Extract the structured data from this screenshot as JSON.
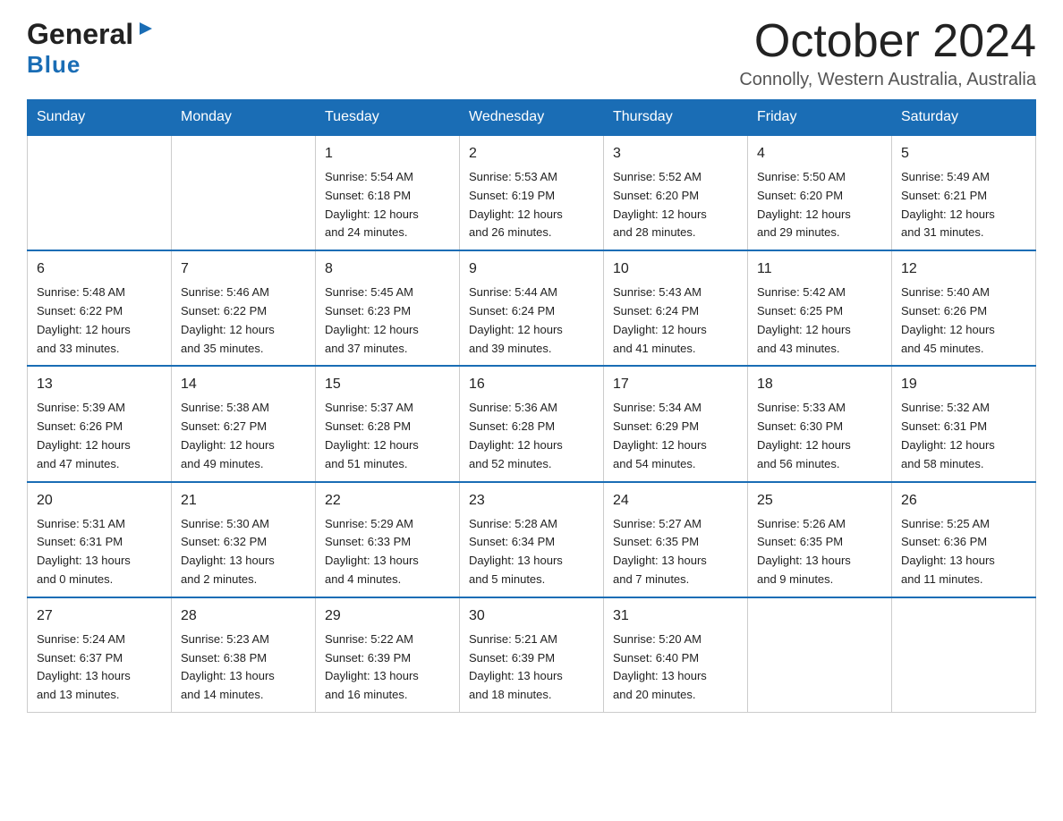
{
  "header": {
    "month_title": "October 2024",
    "location": "Connolly, Western Australia, Australia"
  },
  "logo": {
    "line1": "General",
    "line2": "Blue"
  },
  "days_of_week": [
    "Sunday",
    "Monday",
    "Tuesday",
    "Wednesday",
    "Thursday",
    "Friday",
    "Saturday"
  ],
  "weeks": [
    [
      {
        "day": "",
        "info": ""
      },
      {
        "day": "",
        "info": ""
      },
      {
        "day": "1",
        "info": "Sunrise: 5:54 AM\nSunset: 6:18 PM\nDaylight: 12 hours\nand 24 minutes."
      },
      {
        "day": "2",
        "info": "Sunrise: 5:53 AM\nSunset: 6:19 PM\nDaylight: 12 hours\nand 26 minutes."
      },
      {
        "day": "3",
        "info": "Sunrise: 5:52 AM\nSunset: 6:20 PM\nDaylight: 12 hours\nand 28 minutes."
      },
      {
        "day": "4",
        "info": "Sunrise: 5:50 AM\nSunset: 6:20 PM\nDaylight: 12 hours\nand 29 minutes."
      },
      {
        "day": "5",
        "info": "Sunrise: 5:49 AM\nSunset: 6:21 PM\nDaylight: 12 hours\nand 31 minutes."
      }
    ],
    [
      {
        "day": "6",
        "info": "Sunrise: 5:48 AM\nSunset: 6:22 PM\nDaylight: 12 hours\nand 33 minutes."
      },
      {
        "day": "7",
        "info": "Sunrise: 5:46 AM\nSunset: 6:22 PM\nDaylight: 12 hours\nand 35 minutes."
      },
      {
        "day": "8",
        "info": "Sunrise: 5:45 AM\nSunset: 6:23 PM\nDaylight: 12 hours\nand 37 minutes."
      },
      {
        "day": "9",
        "info": "Sunrise: 5:44 AM\nSunset: 6:24 PM\nDaylight: 12 hours\nand 39 minutes."
      },
      {
        "day": "10",
        "info": "Sunrise: 5:43 AM\nSunset: 6:24 PM\nDaylight: 12 hours\nand 41 minutes."
      },
      {
        "day": "11",
        "info": "Sunrise: 5:42 AM\nSunset: 6:25 PM\nDaylight: 12 hours\nand 43 minutes."
      },
      {
        "day": "12",
        "info": "Sunrise: 5:40 AM\nSunset: 6:26 PM\nDaylight: 12 hours\nand 45 minutes."
      }
    ],
    [
      {
        "day": "13",
        "info": "Sunrise: 5:39 AM\nSunset: 6:26 PM\nDaylight: 12 hours\nand 47 minutes."
      },
      {
        "day": "14",
        "info": "Sunrise: 5:38 AM\nSunset: 6:27 PM\nDaylight: 12 hours\nand 49 minutes."
      },
      {
        "day": "15",
        "info": "Sunrise: 5:37 AM\nSunset: 6:28 PM\nDaylight: 12 hours\nand 51 minutes."
      },
      {
        "day": "16",
        "info": "Sunrise: 5:36 AM\nSunset: 6:28 PM\nDaylight: 12 hours\nand 52 minutes."
      },
      {
        "day": "17",
        "info": "Sunrise: 5:34 AM\nSunset: 6:29 PM\nDaylight: 12 hours\nand 54 minutes."
      },
      {
        "day": "18",
        "info": "Sunrise: 5:33 AM\nSunset: 6:30 PM\nDaylight: 12 hours\nand 56 minutes."
      },
      {
        "day": "19",
        "info": "Sunrise: 5:32 AM\nSunset: 6:31 PM\nDaylight: 12 hours\nand 58 minutes."
      }
    ],
    [
      {
        "day": "20",
        "info": "Sunrise: 5:31 AM\nSunset: 6:31 PM\nDaylight: 13 hours\nand 0 minutes."
      },
      {
        "day": "21",
        "info": "Sunrise: 5:30 AM\nSunset: 6:32 PM\nDaylight: 13 hours\nand 2 minutes."
      },
      {
        "day": "22",
        "info": "Sunrise: 5:29 AM\nSunset: 6:33 PM\nDaylight: 13 hours\nand 4 minutes."
      },
      {
        "day": "23",
        "info": "Sunrise: 5:28 AM\nSunset: 6:34 PM\nDaylight: 13 hours\nand 5 minutes."
      },
      {
        "day": "24",
        "info": "Sunrise: 5:27 AM\nSunset: 6:35 PM\nDaylight: 13 hours\nand 7 minutes."
      },
      {
        "day": "25",
        "info": "Sunrise: 5:26 AM\nSunset: 6:35 PM\nDaylight: 13 hours\nand 9 minutes."
      },
      {
        "day": "26",
        "info": "Sunrise: 5:25 AM\nSunset: 6:36 PM\nDaylight: 13 hours\nand 11 minutes."
      }
    ],
    [
      {
        "day": "27",
        "info": "Sunrise: 5:24 AM\nSunset: 6:37 PM\nDaylight: 13 hours\nand 13 minutes."
      },
      {
        "day": "28",
        "info": "Sunrise: 5:23 AM\nSunset: 6:38 PM\nDaylight: 13 hours\nand 14 minutes."
      },
      {
        "day": "29",
        "info": "Sunrise: 5:22 AM\nSunset: 6:39 PM\nDaylight: 13 hours\nand 16 minutes."
      },
      {
        "day": "30",
        "info": "Sunrise: 5:21 AM\nSunset: 6:39 PM\nDaylight: 13 hours\nand 18 minutes."
      },
      {
        "day": "31",
        "info": "Sunrise: 5:20 AM\nSunset: 6:40 PM\nDaylight: 13 hours\nand 20 minutes."
      },
      {
        "day": "",
        "info": ""
      },
      {
        "day": "",
        "info": ""
      }
    ]
  ]
}
